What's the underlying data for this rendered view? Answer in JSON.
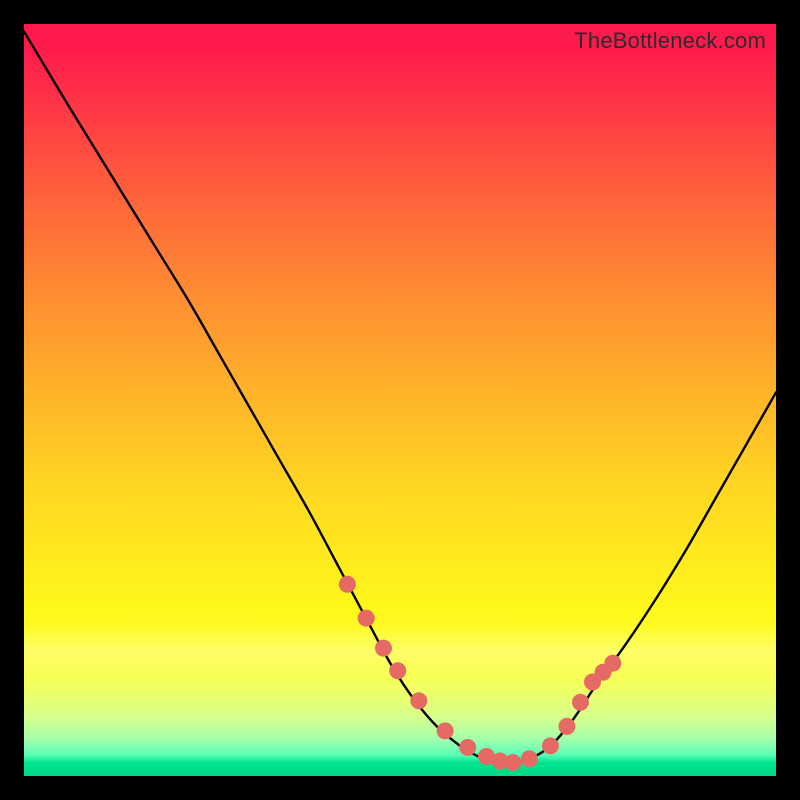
{
  "watermark": "TheBottleneck.com",
  "colors": {
    "background": "#000000",
    "curve": "#000000",
    "marker": "#e46a63",
    "gradient_top": "#ff1a4d",
    "gradient_bottom": "#00d884"
  },
  "chart_data": {
    "type": "line",
    "title": "",
    "xlabel": "",
    "ylabel": "",
    "xlim": [
      0,
      100
    ],
    "ylim": [
      0,
      100
    ],
    "grid": false,
    "legend": false,
    "series": [
      {
        "name": "bottleneck-curve",
        "x": [
          0,
          3,
          6,
          10,
          14,
          18,
          22,
          26,
          30,
          34,
          38,
          42,
          46,
          49,
          52,
          55,
          58,
          60,
          62,
          64,
          67,
          70,
          73,
          76,
          80,
          84,
          88,
          92,
          96,
          100
        ],
        "y": [
          99,
          94,
          89,
          82.5,
          76,
          69.5,
          63,
          56,
          49,
          42,
          35,
          27.5,
          20,
          14.5,
          10,
          6.5,
          4,
          2.8,
          2,
          1.7,
          2.2,
          4,
          7.5,
          12,
          17.5,
          23.5,
          30,
          37,
          44,
          51
        ]
      }
    ],
    "markers": {
      "name": "resolution-points",
      "x": [
        43,
        45.5,
        47.8,
        49.7,
        52.5,
        56,
        59,
        61.5,
        63.3,
        65,
        67.2,
        70,
        72.2,
        74,
        75.6,
        77,
        78.3
      ],
      "y": [
        25.5,
        21,
        17,
        14,
        10,
        6,
        3.8,
        2.6,
        2,
        1.8,
        2.3,
        4,
        6.6,
        9.8,
        12.5,
        13.8,
        15
      ]
    }
  }
}
